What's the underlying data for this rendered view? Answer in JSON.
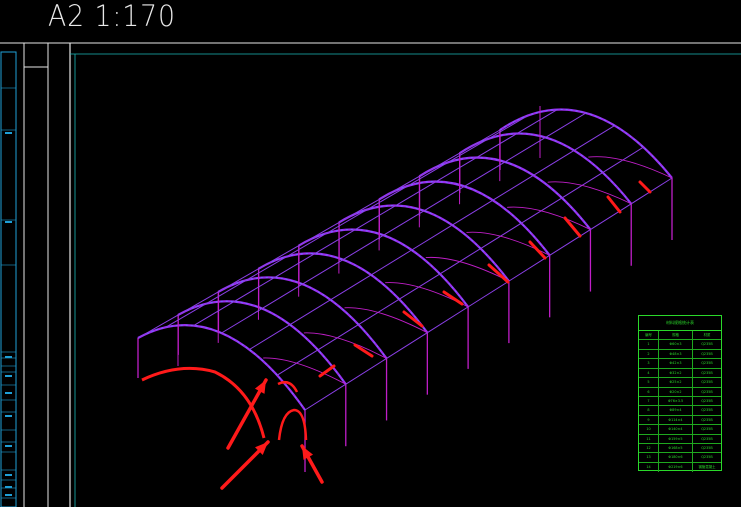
{
  "drawing": {
    "scale_label": "A2  1:170",
    "view": "isometric steel arch shed frame",
    "colors": {
      "background": "#000000",
      "arch_frame": "#9b2cf0",
      "columns": "#c01ec8",
      "purlins": "#8a3fe6",
      "nodes": "#6a74ff",
      "border": "#e6e6e6",
      "inner_border": "#1bb8b8",
      "side_panel": "#1f9fd6",
      "annotation": "#ff1a1a",
      "table": "#2ad82a"
    },
    "arch_count": 10
  },
  "material_table": {
    "title": "材料规格统计表",
    "headers": [
      "编号",
      "规格",
      "材质"
    ],
    "rows": [
      [
        "1",
        "Φ60×3",
        "Q235B"
      ],
      [
        "2",
        "Φ48×3",
        "Q235B"
      ],
      [
        "3",
        "Φ42×3",
        "Q235B"
      ],
      [
        "4",
        "Φ32×2",
        "Q235B"
      ],
      [
        "5",
        "Φ25×2",
        "Q235B"
      ],
      [
        "6",
        "Φ20×2",
        "Q235B"
      ],
      [
        "7",
        "Φ76×3.5",
        "Q235B"
      ],
      [
        "8",
        "Φ89×4",
        "Q235B"
      ],
      [
        "9",
        "Φ114×4",
        "Q235B"
      ],
      [
        "10",
        "Φ140×4",
        "Q235B"
      ],
      [
        "11",
        "Φ159×5",
        "Q235B"
      ],
      [
        "12",
        "Φ168×5",
        "Q235B"
      ],
      [
        "13",
        "Φ180×6",
        "Q235B"
      ],
      [
        "14",
        "Φ219×6",
        "钢管混凝土"
      ]
    ]
  }
}
